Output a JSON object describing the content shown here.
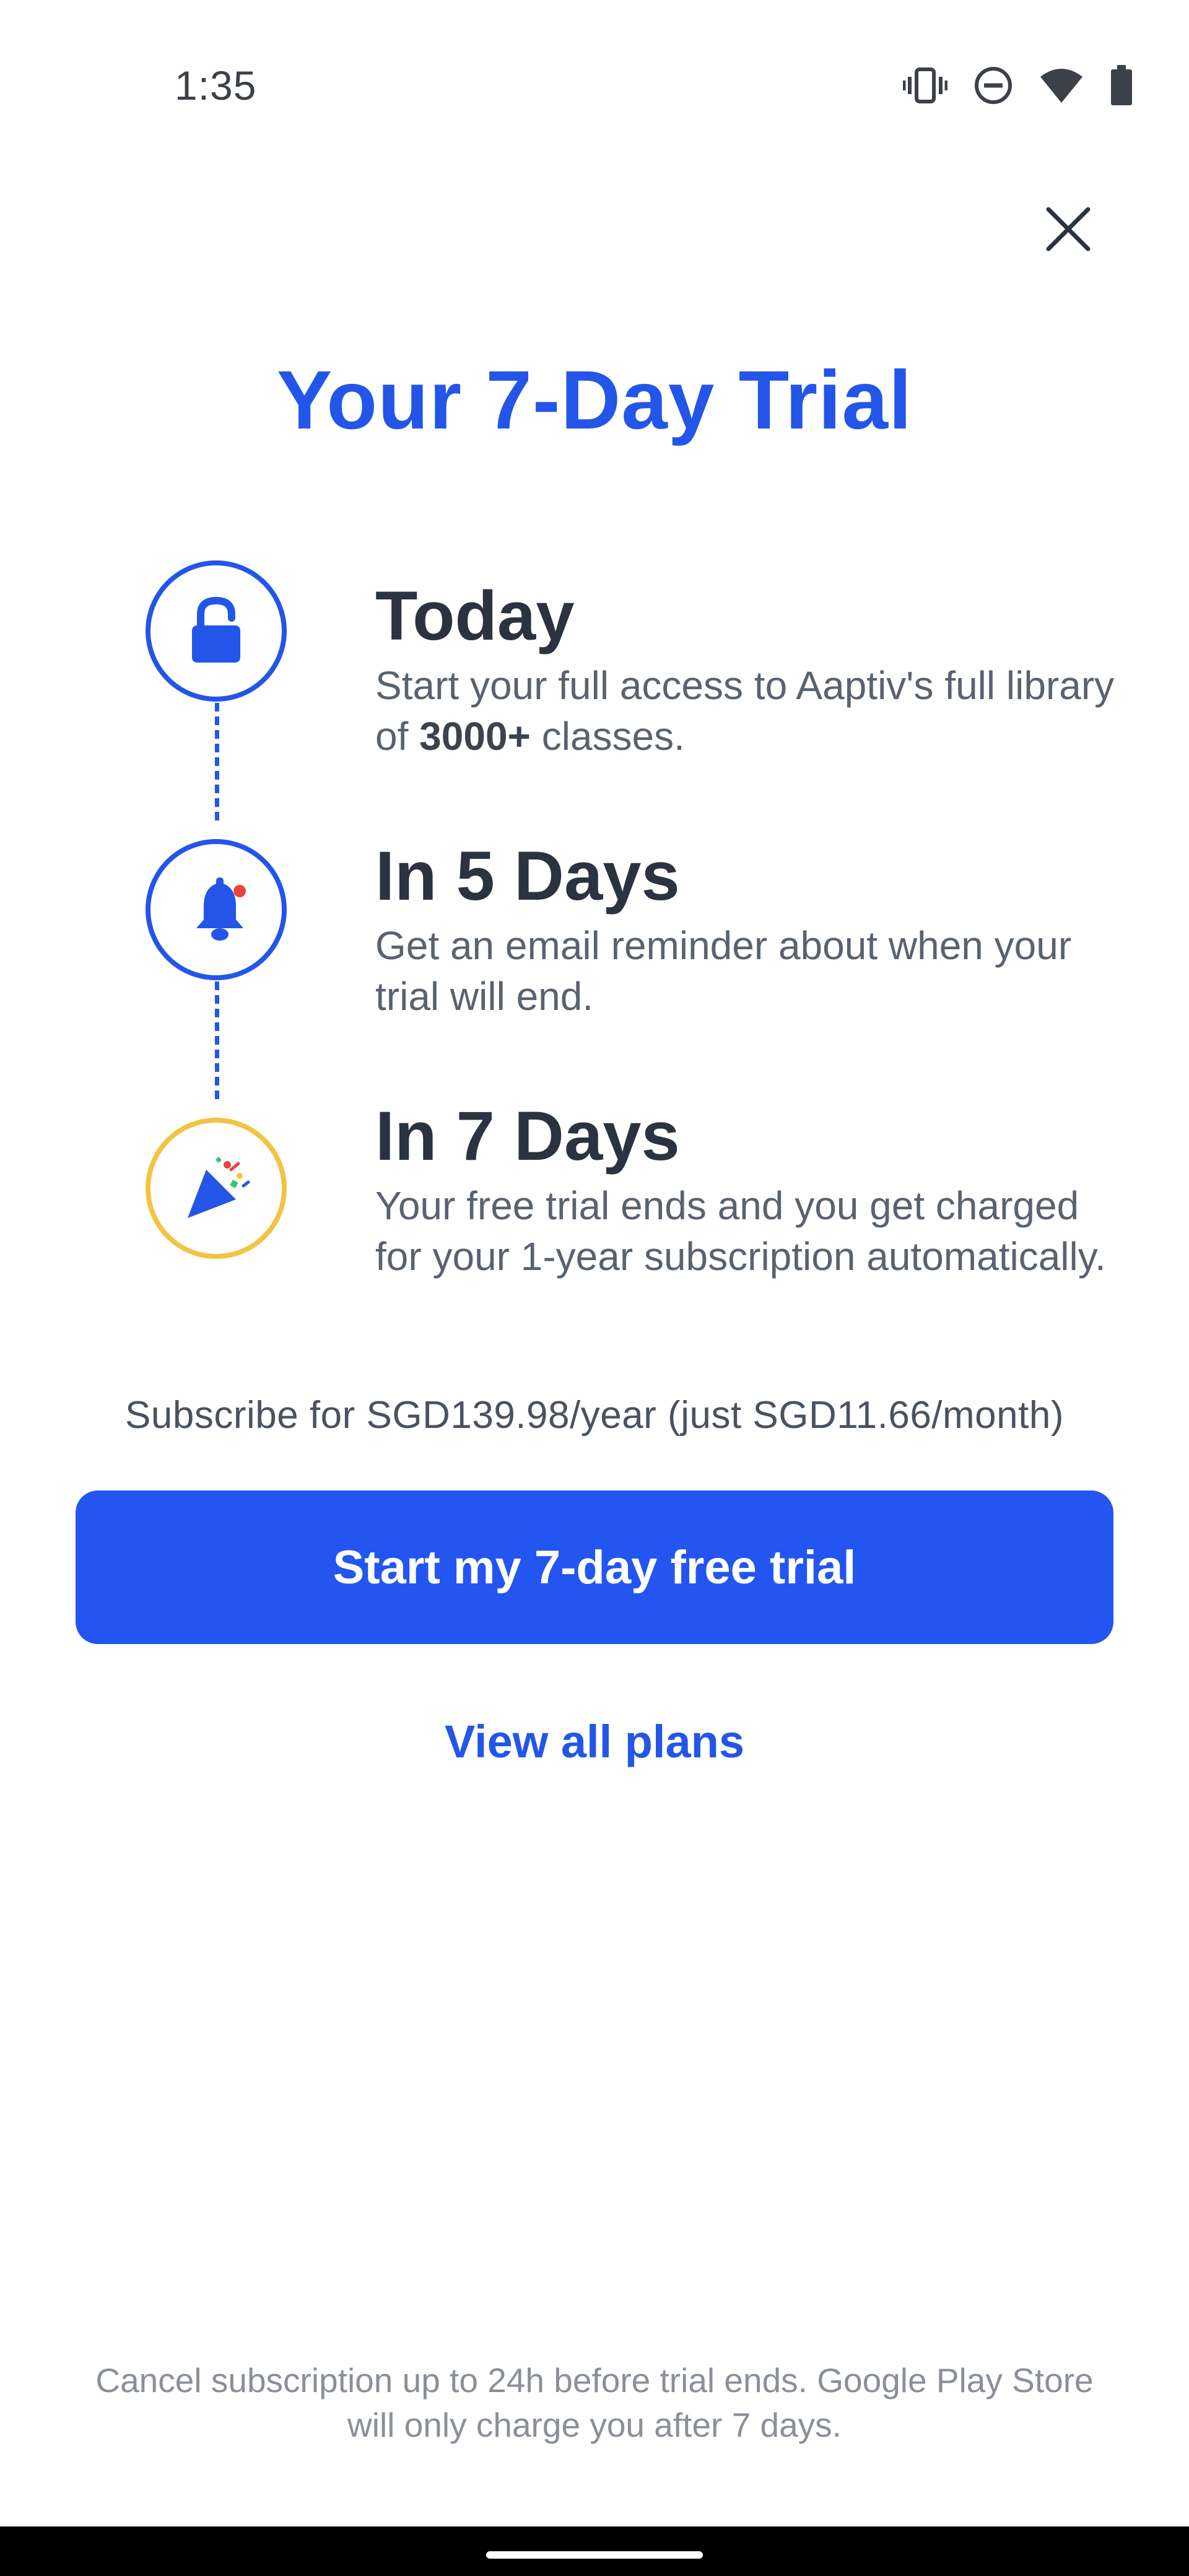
{
  "status_bar": {
    "time": "1:35",
    "icons": [
      "vibrate-icon",
      "do-not-disturb-icon",
      "wifi-icon",
      "battery-icon"
    ]
  },
  "header": {
    "close_icon": "close-icon"
  },
  "title": "Your 7-Day Trial",
  "steps": [
    {
      "heading": "Today",
      "description_pre": "Start your full access to Aaptiv's full library of ",
      "description_bold": "3000+",
      "description_post": " classes.",
      "icon": "unlock-icon",
      "icon_color": "#2356e8"
    },
    {
      "heading": "In 5 Days",
      "description": "Get an email reminder about when your trial will end.",
      "icon": "bell-icon",
      "icon_color": "#2356e8"
    },
    {
      "heading": "In 7 Days",
      "description": "Your free trial ends and you get charged for your 1-year subscription automatically.",
      "icon": "party-popper-icon",
      "icon_color": "#f2c443"
    }
  ],
  "pricing": {
    "line": "Subscribe for SGD139.98/year (just SGD11.66/month)"
  },
  "cta": {
    "label": "Start my 7-day free trial"
  },
  "secondary": {
    "label": "View all plans"
  },
  "footer": {
    "note": "Cancel subscription up to 24h before trial ends. Google Play Store will only charge you after 7 days."
  },
  "colors": {
    "accent": "#2356e8",
    "button": "#2356f0",
    "heading": "#2b3340",
    "gold": "#f2c443",
    "muted": "#8a8f98"
  }
}
